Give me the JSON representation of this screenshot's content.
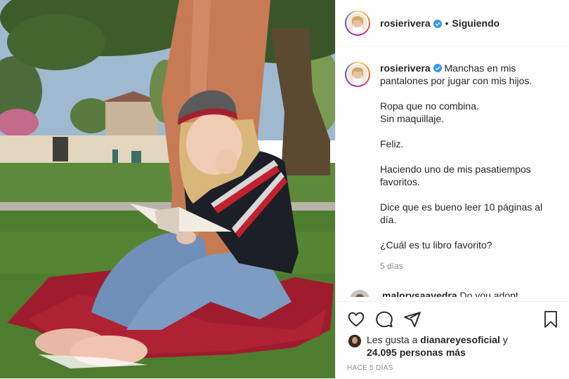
{
  "header": {
    "username": "rosierivera",
    "separator": "•",
    "follow_state": "Siguiendo"
  },
  "caption": {
    "username": "rosierivera",
    "lines": [
      "Manchas en mis",
      "pantalones por jugar con mis hijos.",
      "",
      "Ropa que no combina.",
      "Sin maquillaje.",
      "",
      "Feliz.",
      "",
      "Haciendo uno de mis pasatiempos",
      "favoritos.",
      "",
      "Dice que es bueno leer 10 páginas al",
      "día.",
      "",
      "¿Cuál es tu libro favorito?"
    ],
    "time": "5 días"
  },
  "comment": {
    "username": "malorysaavedra",
    "text": "Do you adopt"
  },
  "actions": {
    "like_icon": "heart-icon",
    "comment_icon": "comment-icon",
    "share_icon": "paper-plane-icon",
    "save_icon": "bookmark-icon"
  },
  "likes": {
    "prefix": "Les gusta a",
    "user": "dianareyesoficial",
    "conj": "y",
    "count": "24.095 personas más"
  },
  "posted": "HACE 5 DÍAS",
  "colors": {
    "verified": "#3897f0",
    "border": "#efefef",
    "muted": "#8e8e8e"
  }
}
